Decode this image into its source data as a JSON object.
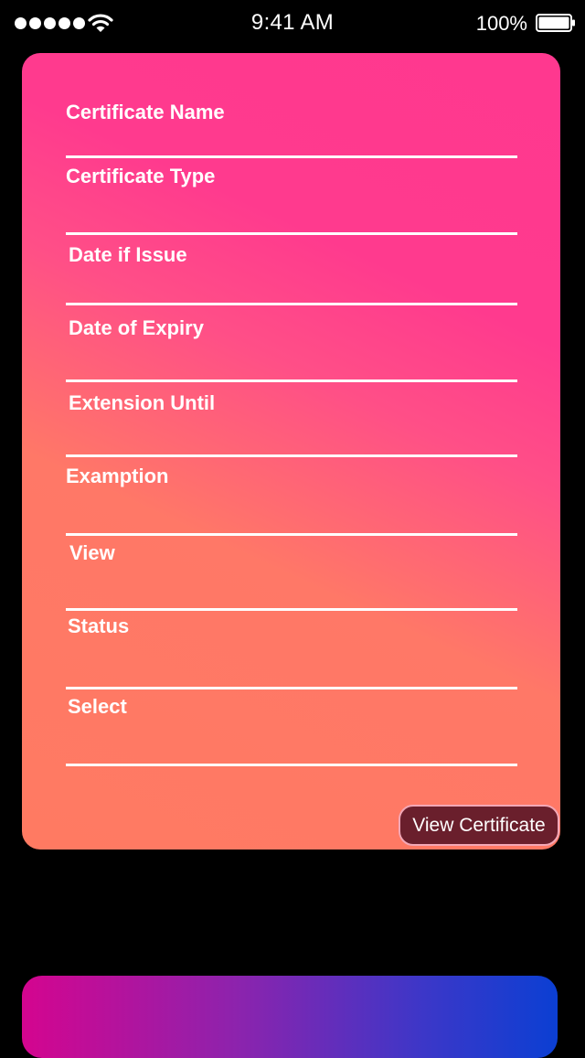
{
  "status_bar": {
    "time": "9:41 AM",
    "battery_percent": "100%",
    "signal_icon": "signal-dots-icon",
    "wifi_icon": "wifi-icon",
    "battery_icon": "battery-icon"
  },
  "form": {
    "fields": [
      {
        "label": "Certificate Name",
        "value": ""
      },
      {
        "label": "Certificate Type",
        "value": ""
      },
      {
        "label": "Date if Issue",
        "value": ""
      },
      {
        "label": "Date of Expiry",
        "value": ""
      },
      {
        "label": "Extension Until",
        "value": ""
      },
      {
        "label": "Examption",
        "value": ""
      },
      {
        "label": "View",
        "value": ""
      },
      {
        "label": "Status",
        "value": ""
      },
      {
        "label": "Select",
        "value": ""
      }
    ],
    "view_certificate_label": "View Certificate"
  },
  "colors": {
    "card_gradient_start": "#ff7a62",
    "card_gradient_end": "#ff388f",
    "button_bg": "#6a1f2c",
    "button_border": "#f2a7b6",
    "bottom_card_start": "#d4058f",
    "bottom_card_end": "#0b3fd3"
  }
}
